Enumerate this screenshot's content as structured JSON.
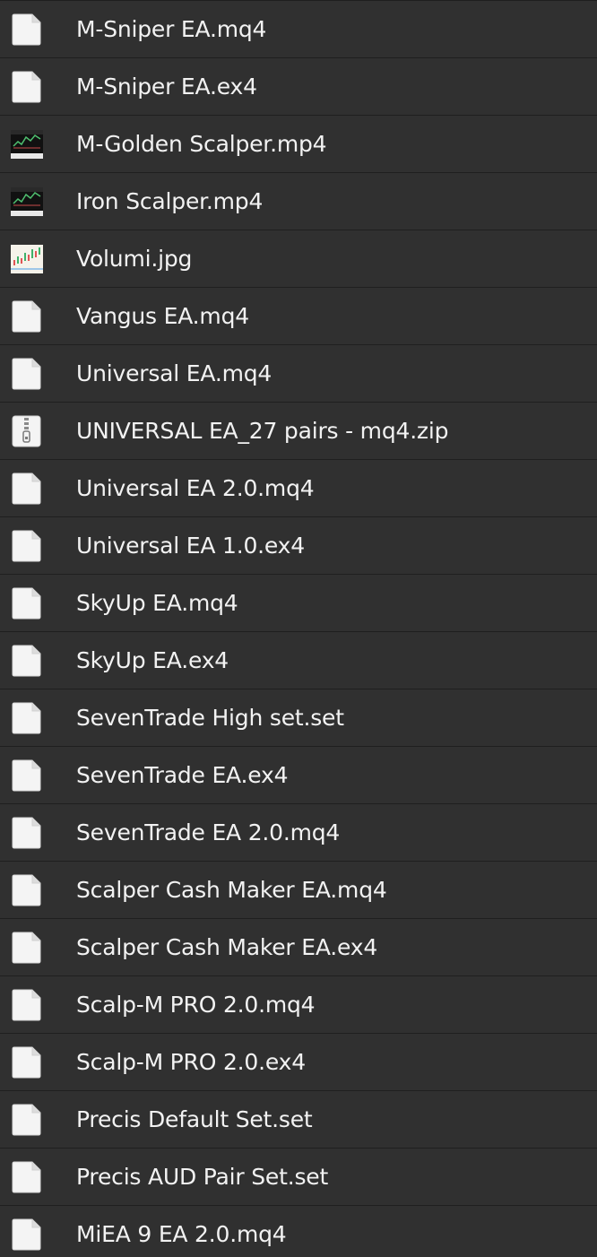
{
  "files": [
    {
      "name": "M-Sniper EA.mq4",
      "icon": "document-icon"
    },
    {
      "name": "M-Sniper EA.ex4",
      "icon": "document-icon"
    },
    {
      "name": "M-Golden Scalper.mp4",
      "icon": "video-thumbnail-icon"
    },
    {
      "name": "Iron Scalper.mp4",
      "icon": "video-thumbnail-icon"
    },
    {
      "name": "Volumi.jpg",
      "icon": "image-thumbnail-icon"
    },
    {
      "name": "Vangus EA.mq4",
      "icon": "document-icon"
    },
    {
      "name": "Universal EA.mq4",
      "icon": "document-icon"
    },
    {
      "name": "UNIVERSAL EA_27 pairs - mq4.zip",
      "icon": "zip-archive-icon"
    },
    {
      "name": "Universal EA 2.0.mq4",
      "icon": "document-icon"
    },
    {
      "name": "Universal EA 1.0.ex4",
      "icon": "document-icon"
    },
    {
      "name": "SkyUp EA.mq4",
      "icon": "document-icon"
    },
    {
      "name": "SkyUp EA.ex4",
      "icon": "document-icon"
    },
    {
      "name": "SevenTrade High set.set",
      "icon": "document-icon"
    },
    {
      "name": "SevenTrade EA.ex4",
      "icon": "document-icon"
    },
    {
      "name": "SevenTrade EA 2.0.mq4",
      "icon": "document-icon"
    },
    {
      "name": "Scalper Cash Maker EA.mq4",
      "icon": "document-icon"
    },
    {
      "name": "Scalper Cash Maker EA.ex4",
      "icon": "document-icon"
    },
    {
      "name": "Scalp-M PRO 2.0.mq4",
      "icon": "document-icon"
    },
    {
      "name": "Scalp-M PRO 2.0.ex4",
      "icon": "document-icon"
    },
    {
      "name": "Precis Default Set.set",
      "icon": "document-icon"
    },
    {
      "name": "Precis AUD Pair Set.set",
      "icon": "document-icon"
    },
    {
      "name": "MiEA 9 EA 2.0.mq4",
      "icon": "document-icon"
    }
  ]
}
